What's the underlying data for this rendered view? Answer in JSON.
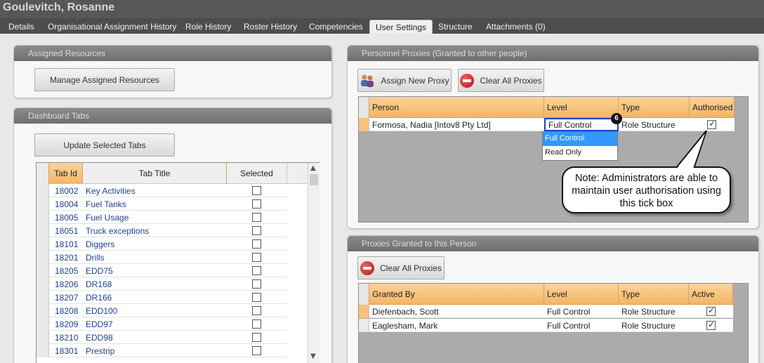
{
  "window": {
    "title": "Goulevitch, Rosanne"
  },
  "tabs": [
    {
      "label": "Details"
    },
    {
      "label": "Organisational Assignment History"
    },
    {
      "label": "Role History"
    },
    {
      "label": "Roster History"
    },
    {
      "label": "Competencies"
    },
    {
      "label": "User Settings"
    },
    {
      "label": "Structure"
    },
    {
      "label": "Attachments (0)"
    }
  ],
  "assigned_resources": {
    "title": "Assigned Resources",
    "button": "Manage Assigned Resources"
  },
  "dashboard_tabs": {
    "title": "Dashboard Tabs",
    "button": "Update Selected Tabs",
    "columns": [
      "Tab Id",
      "Tab Title",
      "Selected"
    ],
    "rows": [
      {
        "id": "18002",
        "title": "Key Activities"
      },
      {
        "id": "18004",
        "title": "Fuel Tanks"
      },
      {
        "id": "18005",
        "title": "Fuel Usage"
      },
      {
        "id": "18051",
        "title": "Truck exceptions"
      },
      {
        "id": "18101",
        "title": "Diggers"
      },
      {
        "id": "18201",
        "title": "Drills"
      },
      {
        "id": "18205",
        "title": "EDD75"
      },
      {
        "id": "18206",
        "title": "DR168"
      },
      {
        "id": "18207",
        "title": "DR166"
      },
      {
        "id": "18208",
        "title": "EDD100"
      },
      {
        "id": "18209",
        "title": "EDD97"
      },
      {
        "id": "18210",
        "title": "EDD98"
      },
      {
        "id": "18301",
        "title": "Prestrip"
      }
    ]
  },
  "personnel_proxies": {
    "title": "Personnel Proxies (Granted to other people)",
    "assign_button": "Assign New Proxy",
    "clear_button": "Clear All Proxies",
    "columns": [
      "Person",
      "Level",
      "Type",
      "Authorised"
    ],
    "rows": [
      {
        "person": "Formosa, Nadia [Intov8 Pty Ltd]",
        "level": "Full Control",
        "type": "Role Structure",
        "authorised": true
      }
    ],
    "level_options": [
      "Full Control",
      "Read Only"
    ],
    "badge": "6"
  },
  "callout": {
    "text": "Note: Administrators are able to maintain user authorisation using this tick box"
  },
  "proxies_granted": {
    "title": "Proxies Granted to this Person",
    "clear_button": "Clear All Proxies",
    "columns": [
      "Granted By",
      "Level",
      "Type",
      "Active"
    ],
    "rows": [
      {
        "granted_by": "Diefenbach, Scott",
        "level": "Full Control",
        "type": "Role Structure",
        "active": true
      },
      {
        "granted_by": "Eaglesham, Mark",
        "level": "Full Control",
        "type": "Role Structure",
        "active": true
      }
    ]
  },
  "colors": {
    "grid_header": "#f4b563",
    "title_bar": "#575757",
    "tab_bar": "#4d4d4d",
    "selection": "#3399ff"
  }
}
